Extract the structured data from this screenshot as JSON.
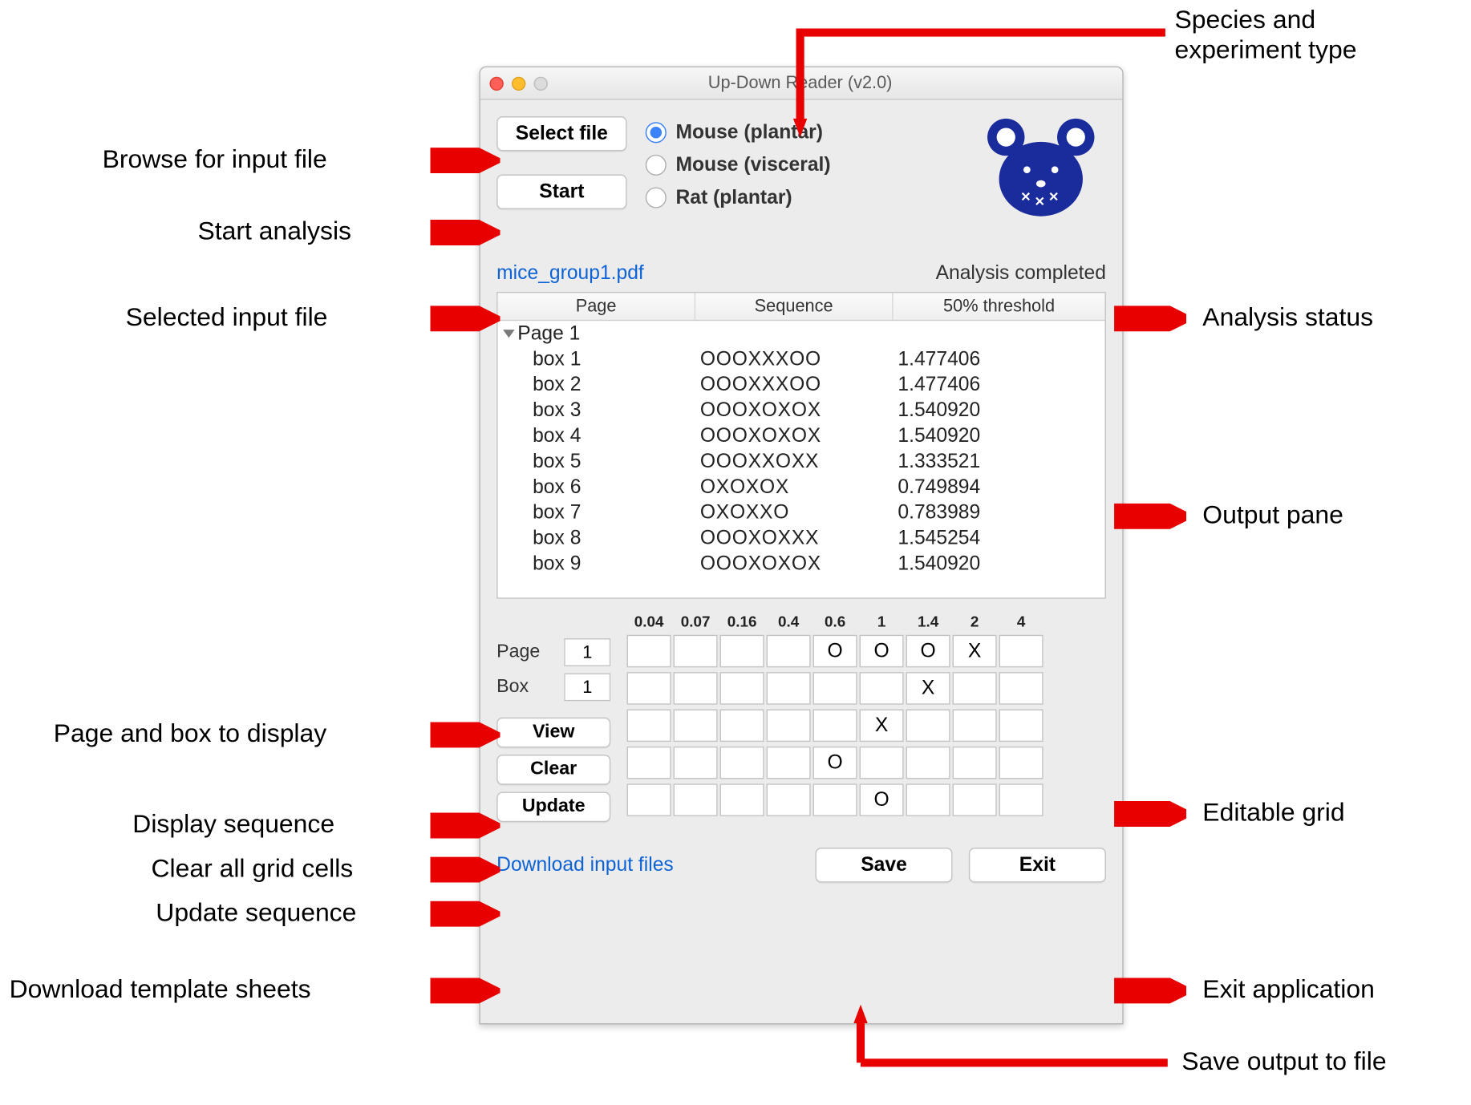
{
  "window": {
    "title": "Up-Down Reader (v2.0)",
    "buttons": {
      "select_file": "Select file",
      "start": "Start",
      "view": "View",
      "clear": "Clear",
      "update": "Update",
      "save": "Save",
      "exit": "Exit"
    },
    "radios": {
      "options": [
        "Mouse (plantar)",
        "Mouse (visceral)",
        "Rat (plantar)"
      ],
      "selected_index": 0
    },
    "selected_file": "mice_group1.pdf",
    "status": "Analysis completed",
    "table": {
      "columns": [
        "Page",
        "Sequence",
        "50% threshold"
      ],
      "page_label": "Page 1",
      "rows": [
        {
          "box": "box 1",
          "seq": "OOOXXXOO",
          "thr": "1.477406"
        },
        {
          "box": "box 2",
          "seq": "OOOXXXOO",
          "thr": "1.477406"
        },
        {
          "box": "box 3",
          "seq": "OOOXOXOX",
          "thr": "1.540920"
        },
        {
          "box": "box 4",
          "seq": "OOOXOXOX",
          "thr": "1.540920"
        },
        {
          "box": "box 5",
          "seq": "OOOXXOXX",
          "thr": "1.333521"
        },
        {
          "box": "box 6",
          "seq": "OXOXOX",
          "thr": "0.749894"
        },
        {
          "box": "box 7",
          "seq": "OXOXXO",
          "thr": "0.783989"
        },
        {
          "box": "box 8",
          "seq": "OOOXOXXX",
          "thr": "1.545254"
        },
        {
          "box": "box 9",
          "seq": "OOOXOXOX",
          "thr": "1.540920"
        }
      ]
    },
    "page_box": {
      "page_label": "Page",
      "box_label": "Box",
      "page_value": "1",
      "box_value": "1"
    },
    "grid": {
      "headers": [
        "0.04",
        "0.07",
        "0.16",
        "0.4",
        "0.6",
        "1",
        "1.4",
        "2",
        "4"
      ],
      "cells": [
        [
          "",
          "",
          "",
          "",
          "O",
          "O",
          "O",
          "X",
          ""
        ],
        [
          "",
          "",
          "",
          "",
          "",
          "",
          "X",
          "",
          ""
        ],
        [
          "",
          "",
          "",
          "",
          "",
          "X",
          "",
          "",
          ""
        ],
        [
          "",
          "",
          "",
          "",
          "O",
          "",
          "",
          "",
          ""
        ],
        [
          "",
          "",
          "",
          "",
          "",
          "O",
          "",
          "",
          ""
        ]
      ]
    },
    "download_link": "Download input files"
  },
  "annotations": {
    "browse": "Browse for input file",
    "start": "Start analysis",
    "selected": "Selected input file",
    "page_box": "Page and box to display",
    "view": "Display sequence",
    "clear": "Clear all grid cells",
    "update": "Update sequence",
    "download": "Download template sheets",
    "species": "Species and\nexperiment type",
    "status": "Analysis status",
    "output": "Output pane",
    "grid": "Editable grid",
    "exit": "Exit application",
    "save": "Save output to file"
  }
}
